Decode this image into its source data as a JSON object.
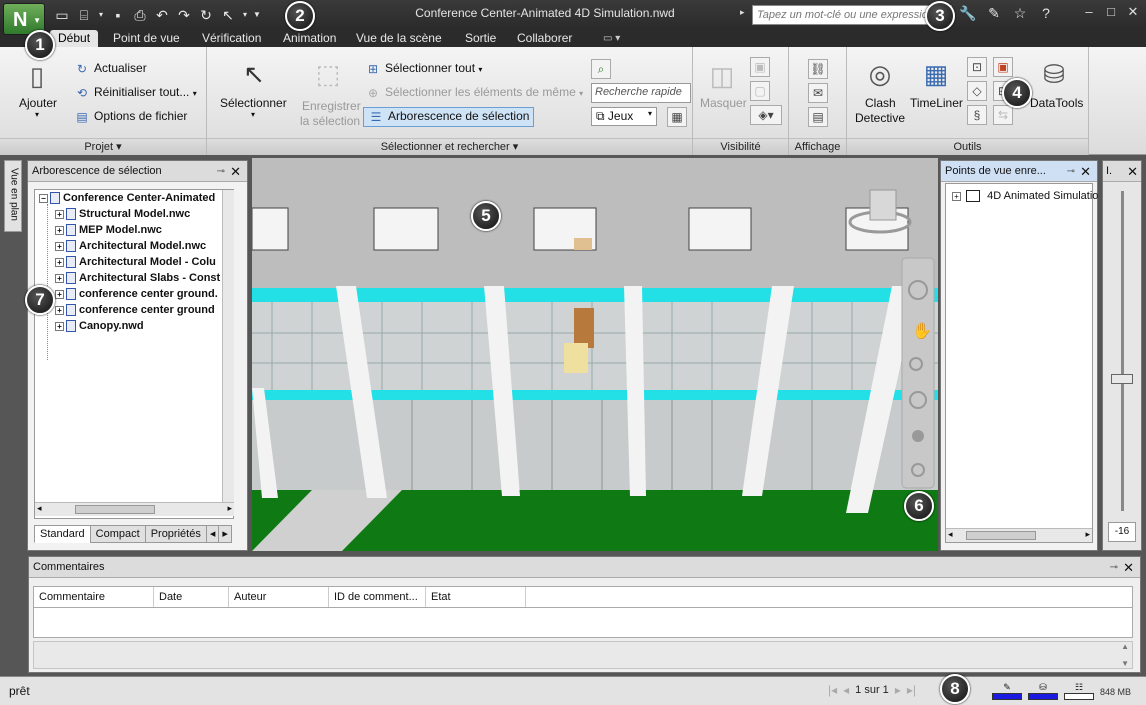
{
  "window": {
    "title": "Conference Center-Animated 4D Simulation.nwd",
    "search_placeholder": "Tapez un mot-clé ou une expression"
  },
  "tabs": [
    "Début",
    "Point de vue",
    "Vérification",
    "Animation",
    "Vue de la scène",
    "Sortie",
    "Collaborer"
  ],
  "ribbon": {
    "projet": {
      "title": "Projet",
      "ajouter": "Ajouter",
      "actualiser": "Actualiser",
      "reinitialiser": "Réinitialiser tout...",
      "options": "Options de fichier"
    },
    "selection": {
      "title": "Sélectionner et rechercher",
      "selectionner": "Sélectionner",
      "enregistrer_1": "Enregistrer",
      "enregistrer_2": "la sélection",
      "selectionner_tout": "Sélectionner tout",
      "selectionner_meme": "Sélectionner les éléments de même",
      "arborescence": "Arborescence de sélection",
      "recherche_placeholder": "Recherche rapide",
      "jeux": "Jeux"
    },
    "visibilite": {
      "title": "Visibilité",
      "masquer": "Masquer"
    },
    "affichage": {
      "title": "Affichage"
    },
    "outils": {
      "title": "Outils",
      "clash_1": "Clash",
      "clash_2": "Detective",
      "timeliner": "TimeLiner",
      "datatools": "DataTools"
    }
  },
  "left_vertical_tab": "Vue en plan",
  "selection_tree": {
    "title": "Arborescence de sélection",
    "root": "Conference Center-Animated",
    "items": [
      "Structural Model.nwc",
      "MEP Model.nwc",
      "Architectural Model.nwc",
      "Architectural Model - Colu",
      "Architectural Slabs - Const",
      "conference center ground.",
      "conference center ground",
      "Canopy.nwd"
    ],
    "bottom_tabs": [
      "Standard",
      "Compact",
      "Propriétés"
    ]
  },
  "viewpoints": {
    "title": "Points de vue enre...",
    "items": [
      "4D Animated Simulatio"
    ]
  },
  "slider": {
    "header": "I.",
    "value": "-16"
  },
  "comments": {
    "title": "Commentaires",
    "columns": [
      "Commentaire",
      "Date",
      "Auteur",
      "ID de comment...",
      "Etat"
    ]
  },
  "status": {
    "text": "prêt",
    "page": "1 sur 1",
    "memory": "848 MB"
  },
  "callouts": [
    "1",
    "2",
    "3",
    "4",
    "5",
    "6",
    "7",
    "8"
  ],
  "colors": {
    "brand_green": "#2f7a2c",
    "ground_green": "#0f7a14",
    "accent_cyan": "#22e0e6",
    "memory_blue": "#1a1ae0"
  }
}
